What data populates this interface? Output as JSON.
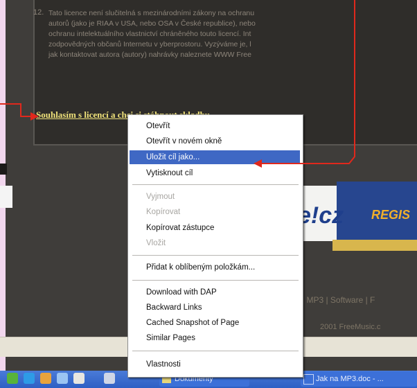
{
  "license": {
    "number": "12.",
    "lines": [
      "Tato licence není slučitelná s mezinárodními zákony na ochranu",
      "autorů (jako je RIAA v USA, nebo OSA v České republice), nebo",
      "ochranu intelektuálního vlastnictví chráněného touto licencí. Int",
      "zodpovědných občanů Internetu v yberprostoru. Vyzýváme je, l",
      "jak kontaktovat autora (autory) nahrávky naleznete WWW Free"
    ],
    "agree_link": "Souhlasím s licencí a chci si stáhnout skladbu"
  },
  "banner": {
    "logo": "e!cz",
    "register": "REGIS"
  },
  "footer": {
    "links": "| MP3 | Software | F",
    "copyright": "2001 FreeMusic.c"
  },
  "context_menu": {
    "items": [
      {
        "label": "Otevřít",
        "enabled": true
      },
      {
        "label": "Otevřít v novém okně",
        "enabled": true
      },
      {
        "label": "Uložit cíl jako...",
        "enabled": true,
        "selected": true
      },
      {
        "label": "Vytisknout cíl",
        "enabled": true
      },
      {
        "label": "Vyjmout",
        "enabled": false
      },
      {
        "label": "Kopírovat",
        "enabled": false
      },
      {
        "label": "Kopírovat zástupce",
        "enabled": true
      },
      {
        "label": "Vložit",
        "enabled": false
      },
      {
        "label": "Přidat k oblíbeným položkám...",
        "enabled": true
      },
      {
        "label": "Download with DAP",
        "enabled": true
      },
      {
        "label": "Backward Links",
        "enabled": true
      },
      {
        "label": "Cached Snapshot of Page",
        "enabled": true
      },
      {
        "label": "Similar Pages",
        "enabled": true
      },
      {
        "label": "Vlastnosti",
        "enabled": true
      }
    ]
  },
  "taskbar": {
    "buttons": [
      {
        "label": "Dokumenty"
      },
      {
        "label": "Jak na MP3.doc - ..."
      }
    ],
    "quicklaunch_icons": [
      "start-icon",
      "browser-icon",
      "media-icon",
      "network-icon",
      "document-icon",
      "window-icon"
    ]
  },
  "colors": {
    "page_bg": "#3f3d3a",
    "link": "#f0e27a",
    "menu_highlight": "#3f68c4",
    "arrow": "#e0281c",
    "frame": "#f2d7ee"
  }
}
